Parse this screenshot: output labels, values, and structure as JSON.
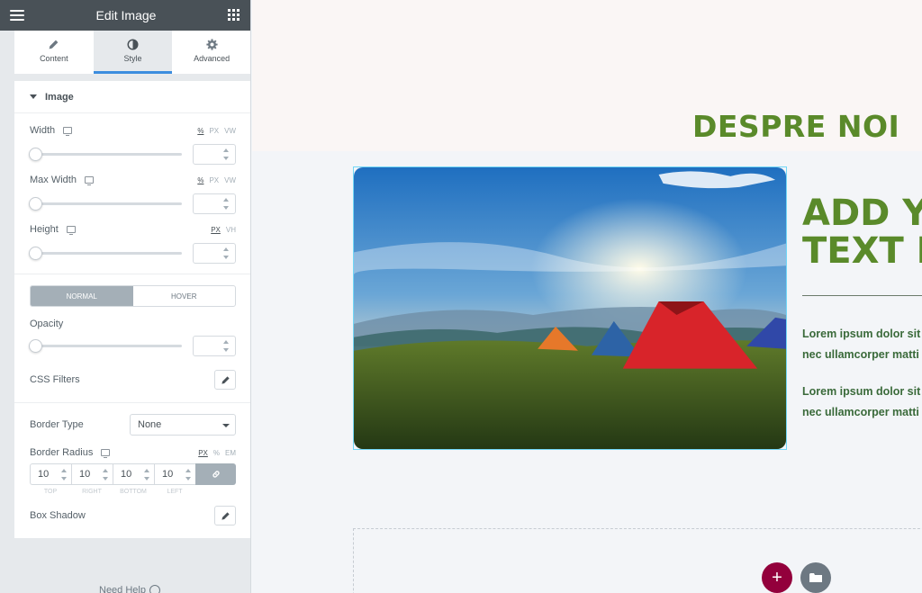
{
  "panel": {
    "title": "Edit Image",
    "tabs": [
      {
        "label": "Content",
        "icon": "pencil-icon"
      },
      {
        "label": "Style",
        "icon": "contrast-icon"
      },
      {
        "label": "Advanced",
        "icon": "gear-icon"
      }
    ],
    "active_tab": "Style",
    "section_title": "Image",
    "width": {
      "label": "Width",
      "units": [
        "%",
        "PX",
        "VW"
      ],
      "active_unit": "%",
      "value": ""
    },
    "max_width": {
      "label": "Max Width",
      "units": [
        "%",
        "PX",
        "VW"
      ],
      "active_unit": "%",
      "value": ""
    },
    "height": {
      "label": "Height",
      "units": [
        "PX",
        "VH"
      ],
      "active_unit": "PX",
      "value": ""
    },
    "state_tabs": {
      "normal": "NORMAL",
      "hover": "HOVER",
      "active": "NORMAL"
    },
    "opacity": {
      "label": "Opacity",
      "value": ""
    },
    "css_filters": "CSS Filters",
    "border_type": {
      "label": "Border Type",
      "value": "None"
    },
    "border_radius": {
      "label": "Border Radius",
      "units": [
        "PX",
        "%",
        "EM"
      ],
      "active_unit": "PX",
      "top": "10",
      "right": "10",
      "bottom": "10",
      "left": "10",
      "labels": {
        "top": "TOP",
        "right": "RIGHT",
        "bottom": "BOTTOM",
        "left": "LEFT"
      }
    },
    "box_shadow": "Box Shadow",
    "need_help": "Need Help"
  },
  "preview": {
    "section_title": "DESPRE NOI",
    "headline_line1": "ADD Y",
    "headline_line2": "TEXT I",
    "para1_line1": "Lorem ipsum dolor sit",
    "para1_line2": "nec ullamcorper matti",
    "para2_line1": "Lorem ipsum dolor sit",
    "para2_line2": "nec ullamcorper matti"
  },
  "colors": {
    "accent_green": "#5a8a2a",
    "panel_dark": "#495157",
    "add_button": "#93003c",
    "selection_outline": "#71d7f7"
  }
}
